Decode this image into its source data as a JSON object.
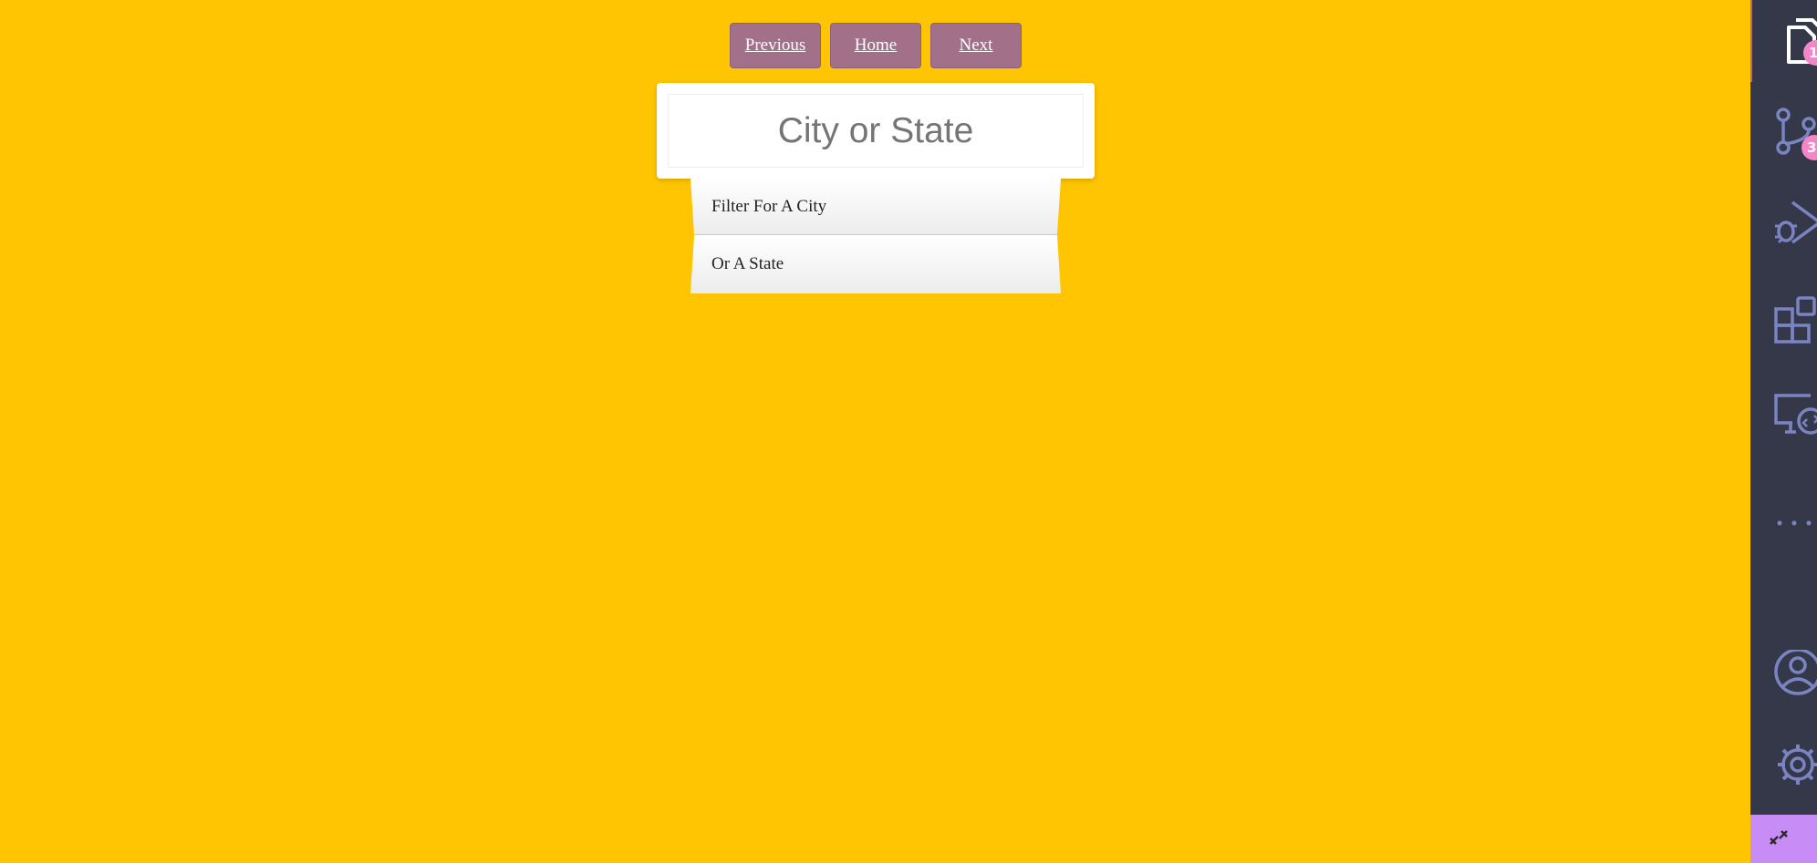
{
  "nav": {
    "previous_label": "Previous",
    "home_label": "Home",
    "next_label": "Next"
  },
  "search": {
    "placeholder": "City or State"
  },
  "suggestions": [
    {
      "label": "Filter For A City"
    },
    {
      "label": "Or A State"
    }
  ],
  "activity_bar": {
    "items": [
      {
        "icon": "files-icon",
        "badge": "1"
      },
      {
        "icon": "source-control-icon",
        "badge": "3"
      },
      {
        "icon": "run-debug-icon"
      },
      {
        "icon": "extensions-icon"
      },
      {
        "icon": "remote-explorer-icon"
      },
      {
        "icon": "more-icon"
      },
      {
        "icon": "account-icon"
      },
      {
        "icon": "settings-gear-icon"
      }
    ],
    "remote_icon": "remote-indicator-icon"
  },
  "colors": {
    "background": "#ffc502",
    "nav_button": "#a3708a",
    "activity_bar": "#353848",
    "badge": "#f584c9",
    "remote": "#c88cf7"
  }
}
